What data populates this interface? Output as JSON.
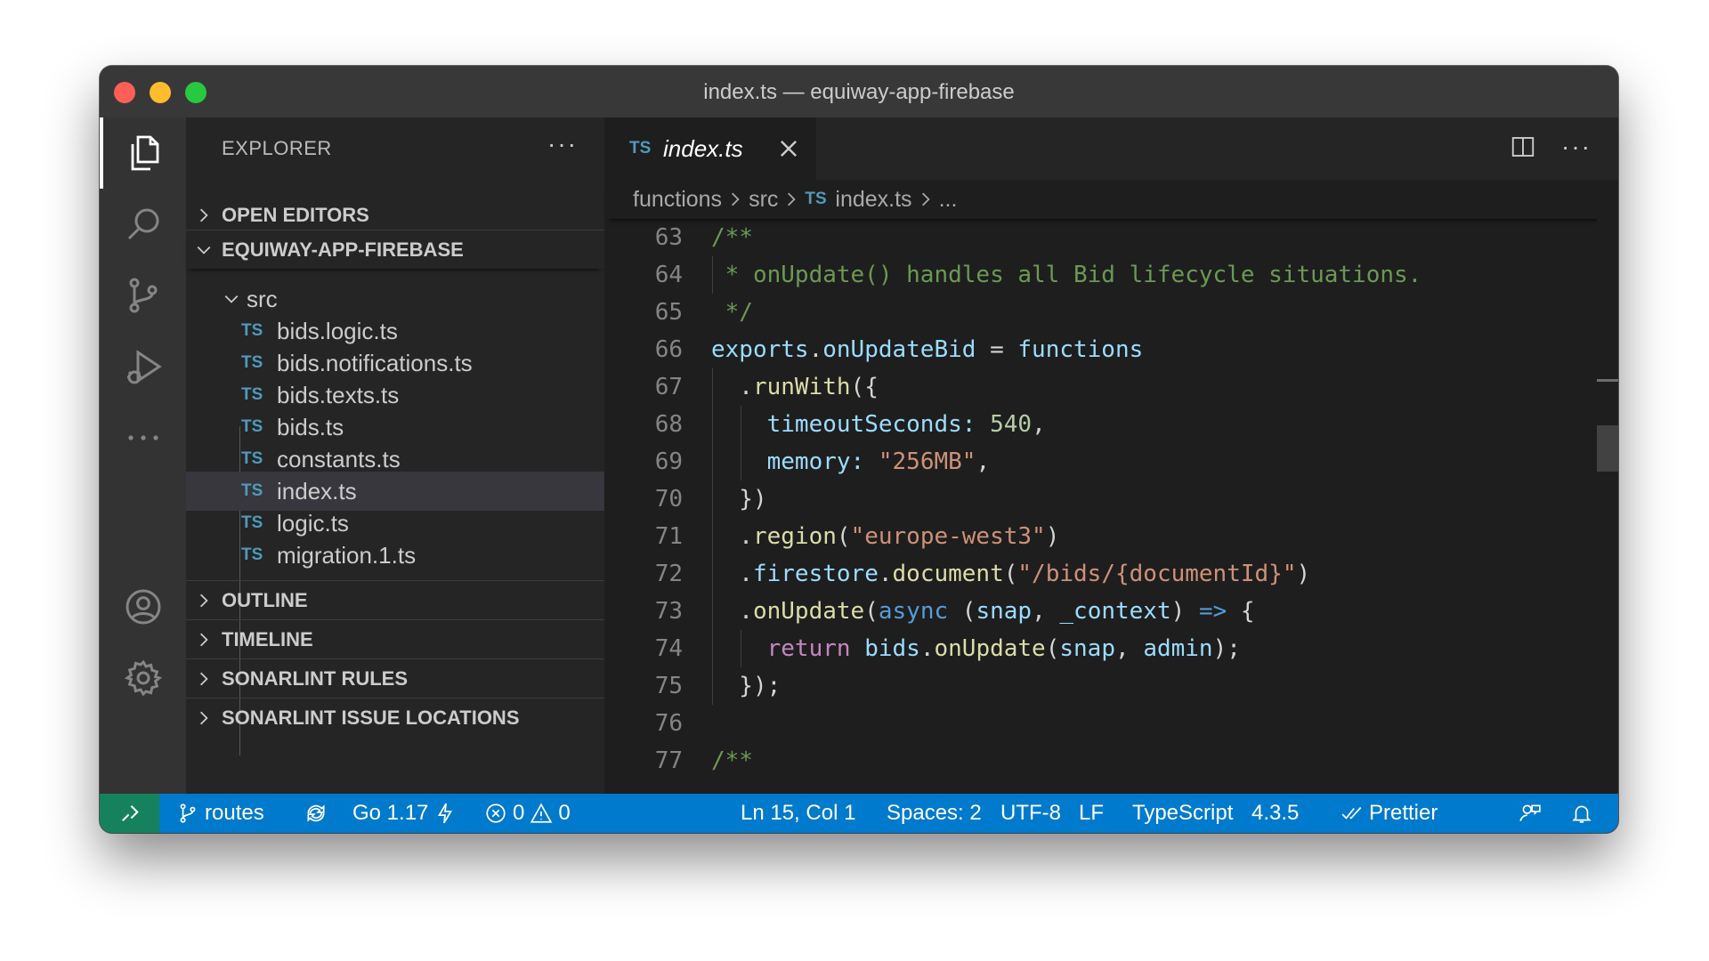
{
  "window": {
    "title": "index.ts — equiway-app-firebase"
  },
  "sidebar": {
    "header": "EXPLORER",
    "more": "···",
    "open_editors": "OPEN EDITORS",
    "project": "EQUIWAY-APP-FIREBASE",
    "folder": "src",
    "files": [
      {
        "badge": "TS",
        "name": "bids.logic.ts"
      },
      {
        "badge": "TS",
        "name": "bids.notifications.ts"
      },
      {
        "badge": "TS",
        "name": "bids.texts.ts"
      },
      {
        "badge": "TS",
        "name": "bids.ts"
      },
      {
        "badge": "TS",
        "name": "constants.ts"
      },
      {
        "badge": "TS",
        "name": "index.ts"
      },
      {
        "badge": "TS",
        "name": "logic.ts"
      },
      {
        "badge": "TS",
        "name": "migration.1.ts"
      }
    ],
    "sections": [
      "OUTLINE",
      "TIMELINE",
      "SONARLINT RULES",
      "SONARLINT ISSUE LOCATIONS"
    ]
  },
  "editor": {
    "tab": {
      "badge": "TS",
      "label": "index.ts"
    },
    "more": "···",
    "breadcrumb": {
      "folder1": "functions",
      "folder2": "src",
      "badge": "TS",
      "file": "index.ts",
      "ellipsis": "..."
    },
    "lines": [
      {
        "n": "63",
        "tokens": [
          [
            "cm",
            "/**"
          ]
        ]
      },
      {
        "n": "64",
        "tokens": [
          [
            "cm",
            " * onUpdate() handles all Bid lifecycle situations."
          ]
        ]
      },
      {
        "n": "65",
        "tokens": [
          [
            "cm",
            " */"
          ]
        ]
      },
      {
        "n": "66",
        "tokens": [
          [
            "var",
            "exports"
          ],
          [
            "pun",
            "."
          ],
          [
            "var",
            "onUpdateBid"
          ],
          [
            "pun",
            " = "
          ],
          [
            "var",
            "functions"
          ]
        ]
      },
      {
        "n": "67",
        "tokens": [
          [
            "pun",
            "  ."
          ],
          [
            "fn",
            "runWith"
          ],
          [
            "pun",
            "({"
          ]
        ]
      },
      {
        "n": "68",
        "tokens": [
          [
            "pun",
            "    "
          ],
          [
            "var",
            "timeoutSeconds"
          ],
          [
            "var",
            ":"
          ],
          [
            "pun",
            " "
          ],
          [
            "num",
            "540"
          ],
          [
            "pun",
            ","
          ]
        ]
      },
      {
        "n": "69",
        "tokens": [
          [
            "pun",
            "    "
          ],
          [
            "var",
            "memory"
          ],
          [
            "var",
            ":"
          ],
          [
            "pun",
            " "
          ],
          [
            "str",
            "\"256MB\""
          ],
          [
            "pun",
            ","
          ]
        ]
      },
      {
        "n": "70",
        "tokens": [
          [
            "pun",
            "  })"
          ]
        ]
      },
      {
        "n": "71",
        "tokens": [
          [
            "pun",
            "  ."
          ],
          [
            "fn",
            "region"
          ],
          [
            "pun",
            "("
          ],
          [
            "str",
            "\"europe-west3\""
          ],
          [
            "pun",
            ")"
          ]
        ]
      },
      {
        "n": "72",
        "tokens": [
          [
            "pun",
            "  ."
          ],
          [
            "var",
            "firestore"
          ],
          [
            "pun",
            "."
          ],
          [
            "fn",
            "document"
          ],
          [
            "pun",
            "("
          ],
          [
            "str",
            "\"/bids/{documentId}\""
          ],
          [
            "pun",
            ")"
          ]
        ]
      },
      {
        "n": "73",
        "tokens": [
          [
            "pun",
            "  ."
          ],
          [
            "fn",
            "onUpdate"
          ],
          [
            "pun",
            "("
          ],
          [
            "kw",
            "async"
          ],
          [
            "pun",
            " ("
          ],
          [
            "var",
            "snap"
          ],
          [
            "pun",
            ", "
          ],
          [
            "var",
            "_context"
          ],
          [
            "pun",
            ") "
          ],
          [
            "kw",
            "=>"
          ],
          [
            "pun",
            " {"
          ]
        ]
      },
      {
        "n": "74",
        "tokens": [
          [
            "pun",
            "    "
          ],
          [
            "ctl",
            "return"
          ],
          [
            "pun",
            " "
          ],
          [
            "var",
            "bids"
          ],
          [
            "pun",
            "."
          ],
          [
            "fn",
            "onUpdate"
          ],
          [
            "pun",
            "("
          ],
          [
            "var",
            "snap"
          ],
          [
            "pun",
            ", "
          ],
          [
            "var",
            "admin"
          ],
          [
            "pun",
            ");"
          ]
        ]
      },
      {
        "n": "75",
        "tokens": [
          [
            "pun",
            "  });"
          ]
        ]
      },
      {
        "n": "76",
        "tokens": []
      },
      {
        "n": "77",
        "tokens": [
          [
            "cm",
            "/**"
          ]
        ]
      }
    ]
  },
  "statusbar": {
    "branch": "routes",
    "go": "Go 1.17",
    "errors": "0",
    "warnings": "0",
    "position": "Ln 15, Col 1",
    "spaces": "Spaces: 2",
    "encoding": "UTF-8",
    "eol": "LF",
    "language": "TypeScript",
    "version": "4.3.5",
    "prettier": "Prettier"
  },
  "colors": {
    "statusbar": "#007acc",
    "remote": "#16825d",
    "ts_badge": "#519aba",
    "comment": "#6a9955",
    "variable": "#9cdcfe",
    "function": "#dcdcaa",
    "string": "#ce9178",
    "number": "#b5cea8",
    "keyword": "#569cd6"
  }
}
